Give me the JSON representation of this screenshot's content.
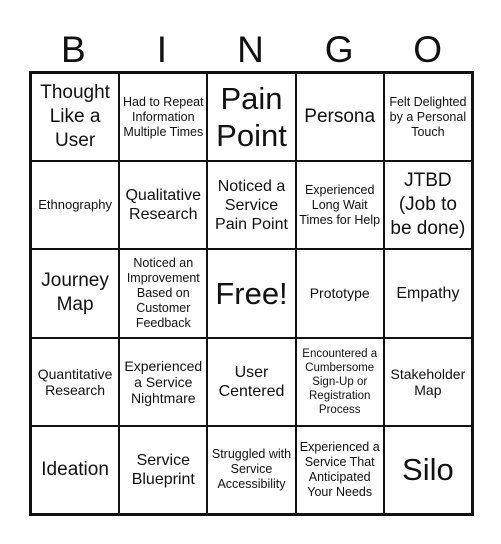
{
  "title_letters": [
    "B",
    "I",
    "N",
    "G",
    "O"
  ],
  "rows": [
    [
      {
        "text": "Thought Like a User",
        "size": "s-m"
      },
      {
        "text": "Had to Repeat Information Multiple Times",
        "size": "s-xs"
      },
      {
        "text": "Pain Point",
        "size": "s-xl"
      },
      {
        "text": "Persona",
        "size": "s-m"
      },
      {
        "text": "Felt Delighted by a Personal Touch",
        "size": "s-xs"
      }
    ],
    [
      {
        "text": "Ethnography",
        "size": "s-eth"
      },
      {
        "text": "Qualitative Research",
        "size": "s-md"
      },
      {
        "text": "Noticed a Service Pain Point",
        "size": "s-md"
      },
      {
        "text": "Experienced Long Wait Times for Help",
        "size": "s-xs"
      },
      {
        "text": "JTBD (Job to be done)",
        "size": "s-m"
      }
    ],
    [
      {
        "text": "Journey Map",
        "size": "s-m"
      },
      {
        "text": "Noticed an Improvement Based on Customer Feedback",
        "size": "s-xs"
      },
      {
        "text": "Free!",
        "size": "s-xl"
      },
      {
        "text": "Prototype",
        "size": "s-sm"
      },
      {
        "text": "Empathy",
        "size": "s-md"
      }
    ],
    [
      {
        "text": "Quantitative Research",
        "size": "s-sm"
      },
      {
        "text": "Experienced a Service Nightmare",
        "size": "s-sm"
      },
      {
        "text": "User Centered",
        "size": "s-md"
      },
      {
        "text": "Encountered a Cumbersome Sign-Up or Registration Process",
        "size": "s-xxs"
      },
      {
        "text": "Stakeholder Map",
        "size": "s-sm"
      }
    ],
    [
      {
        "text": "Ideation",
        "size": "s-m"
      },
      {
        "text": "Service Blueprint",
        "size": "s-md"
      },
      {
        "text": "Struggled with Service Accessibility",
        "size": "s-xs"
      },
      {
        "text": "Experienced a Service That Anticipated Your Needs",
        "size": "s-xs"
      },
      {
        "text": "Silo",
        "size": "s-xl"
      }
    ]
  ]
}
